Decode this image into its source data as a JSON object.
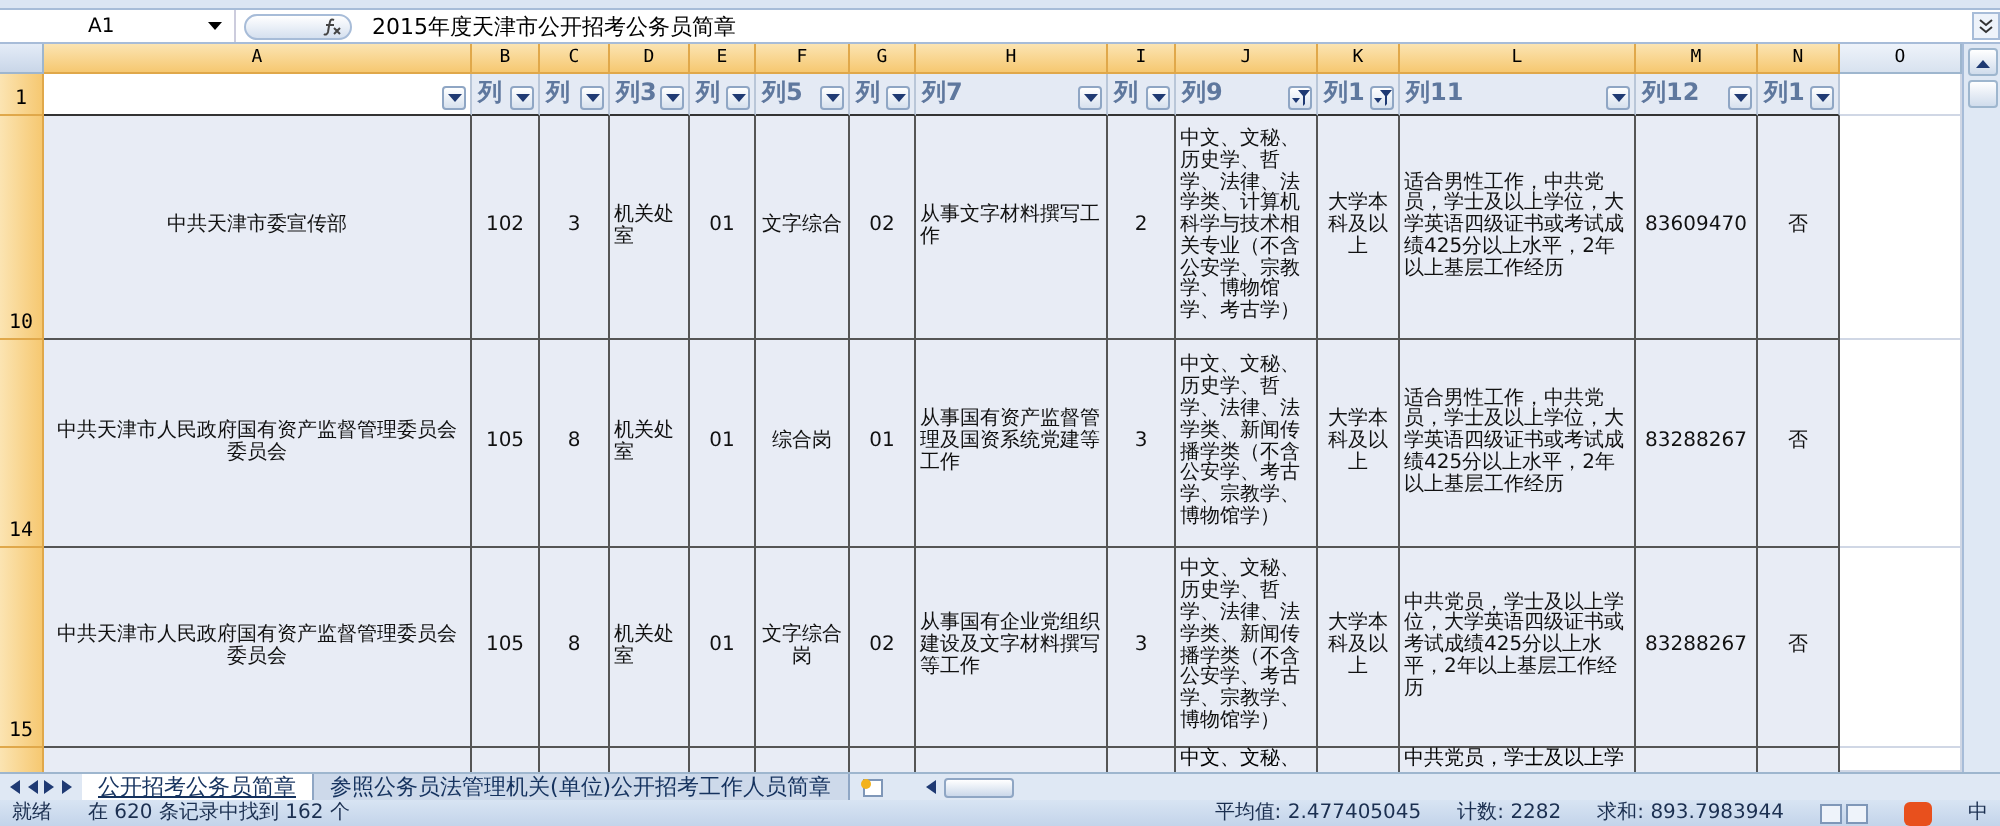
{
  "formula_bar": {
    "name_box": "A1",
    "formula": "2015年度天津市公开招考公务员简章"
  },
  "columns": [
    {
      "label": "A",
      "selected": true
    },
    {
      "label": "B",
      "selected": true
    },
    {
      "label": "C",
      "selected": true
    },
    {
      "label": "D",
      "selected": true
    },
    {
      "label": "E",
      "selected": true
    },
    {
      "label": "F",
      "selected": true
    },
    {
      "label": "G",
      "selected": true
    },
    {
      "label": "H",
      "selected": true
    },
    {
      "label": "I",
      "selected": true
    },
    {
      "label": "J",
      "selected": true
    },
    {
      "label": "K",
      "selected": true
    },
    {
      "label": "L",
      "selected": true
    },
    {
      "label": "M",
      "selected": true
    },
    {
      "label": "N",
      "selected": true
    },
    {
      "label": "O",
      "selected": false
    }
  ],
  "header_row": {
    "row_label": "1",
    "cells": [
      {
        "filter_active": false
      },
      {
        "label": "列",
        "filter_active": false
      },
      {
        "label": "列",
        "filter_active": false
      },
      {
        "label": "列3",
        "filter_active": false
      },
      {
        "label": "列",
        "filter_active": false
      },
      {
        "label": "列5",
        "filter_active": false
      },
      {
        "label": "列",
        "filter_active": false
      },
      {
        "label": "列7",
        "filter_active": false
      },
      {
        "label": "列",
        "filter_active": false
      },
      {
        "label": "列9",
        "filter_active": true
      },
      {
        "label": "列1",
        "filter_active": true
      },
      {
        "label": "列11",
        "filter_active": false
      },
      {
        "label": "列12",
        "filter_active": false
      },
      {
        "label": "列1",
        "filter_active": false
      }
    ]
  },
  "rows": [
    {
      "row_label": "10",
      "cells": [
        "中共天津市委宣传部",
        "102",
        "3",
        "机关处室",
        "01",
        "文字综合",
        "02",
        "从事文字材料撰写工作",
        "2",
        "中文、文秘、历史学、哲学、法律、法学类、计算机科学与技术相关专业（不含公安学、宗教学、博物馆学、考古学）",
        "大学本科及以上",
        "适合男性工作，中共党员，学士及以上学位，大学英语四级证书或考试成绩425分以上水平，2年以上基层工作经历",
        "83609470",
        "否"
      ]
    },
    {
      "row_label": "14",
      "cells": [
        "中共天津市人民政府国有资产监督管理委员会委员会",
        "105",
        "8",
        "机关处室",
        "01",
        "综合岗",
        "01",
        "从事国有资产监督管理及国资系统党建等工作",
        "3",
        "中文、文秘、历史学、哲学、法律、法学类、新闻传播学类（不含公安学、考古学、宗教学、博物馆学）",
        "大学本科及以上",
        "适合男性工作，中共党员，学士及以上学位，大学英语四级证书或考试成绩425分以上水平，2年以上基层工作经历",
        "83288267",
        "否"
      ]
    },
    {
      "row_label": "15",
      "cells": [
        "中共天津市人民政府国有资产监督管理委员会委员会",
        "105",
        "8",
        "机关处室",
        "01",
        "文字综合岗",
        "02",
        "从事国有企业党组织建设及文字材料撰写等工作",
        "3",
        "中文、文秘、历史学、哲学、法律、法学类、新闻传播学类（不含公安学、考古学、宗教学、博物馆学）",
        "大学本科及以上",
        "中共党员，学士及以上学位，大学英语四级证书或考试成绩425分以上水平，2年以上基层工作经历",
        "83288267",
        "否"
      ]
    }
  ],
  "partial_row": {
    "column_j": "中文、文秘、",
    "column_l": "中共党员，学士及以上学"
  },
  "sheet_tabs": [
    {
      "label": "公开招考公务员简章",
      "selected": true
    },
    {
      "label": "参照公务员法管理机关(单位)公开招考工作人员简章",
      "selected": false
    }
  ],
  "status_bar": {
    "mode": "就绪",
    "filter_info": "在 620 条记录中找到 162 个",
    "average": "平均值: 2.477405045",
    "count": "计数: 2282",
    "sum": "求和: 893.7983944",
    "ime_label": "中"
  }
}
